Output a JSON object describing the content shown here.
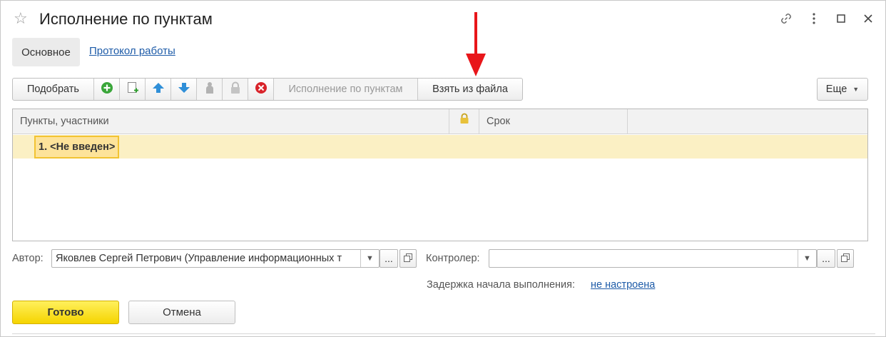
{
  "window": {
    "title": "Исполнение по пунктам"
  },
  "tabs": [
    {
      "label": "Основное",
      "active": true
    },
    {
      "label": "Протокол работы",
      "active": false
    }
  ],
  "toolbar": {
    "pick_label": "Подобрать",
    "execution_label": "Исполнение по пунктам",
    "from_file_label": "Взять из файла",
    "more_label": "Еще"
  },
  "table": {
    "columns": [
      "Пункты, участники",
      "Срок"
    ],
    "rows": [
      {
        "item": "1. <Не введен>"
      }
    ]
  },
  "form": {
    "author_label": "Автор:",
    "author_value": "Яковлев Сергей Петрович (Управление информационных т",
    "controller_label": "Контролер:",
    "controller_value": "",
    "delay_label": "Задержка начала выполнения:",
    "delay_value": "не настроена",
    "dots": "..."
  },
  "buttons": {
    "done_label": "Готово",
    "cancel_label": "Отмена"
  },
  "colors": {
    "accent_arrow": "#e8161a",
    "selected_row": "#fbf0c4",
    "primary_button": "#f5d400",
    "link": "#1d5ba8"
  }
}
